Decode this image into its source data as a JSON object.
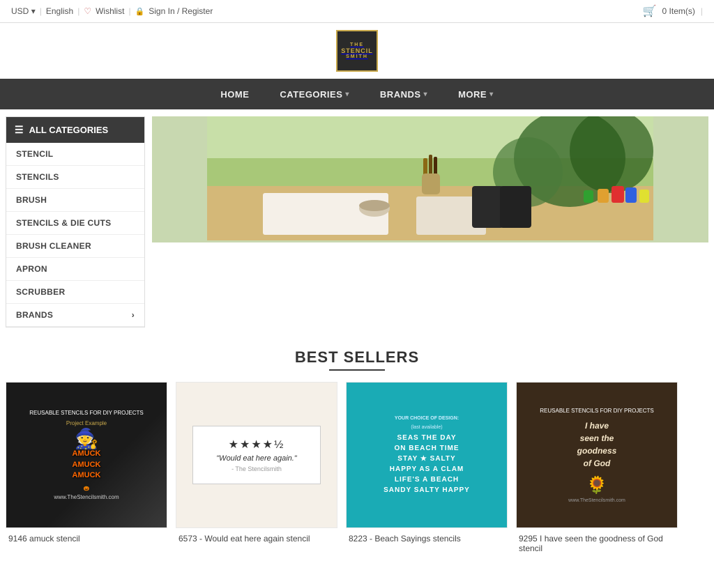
{
  "topbar": {
    "currency": "USD",
    "currency_arrow": "▾",
    "sep1": "|",
    "language": "English",
    "sep2": "|",
    "wishlist": "Wishlist",
    "sep3": "|",
    "signin": "Sign In / Register",
    "sep4": "|",
    "cart_label": "0 Item(s)",
    "sep5": "|"
  },
  "logo": {
    "line1": "THE",
    "line2": "STENCIL",
    "line3": "SMITH"
  },
  "nav": {
    "items": [
      {
        "label": "HOME",
        "has_dropdown": false
      },
      {
        "label": "CATEGORIES",
        "has_dropdown": true
      },
      {
        "label": "BRANDS",
        "has_dropdown": true
      },
      {
        "label": "MORE",
        "has_dropdown": true
      }
    ]
  },
  "sidebar": {
    "header": "ALL CATEGORIES",
    "items": [
      {
        "label": "STENCIL",
        "has_arrow": false
      },
      {
        "label": "STENCILS",
        "has_arrow": false
      },
      {
        "label": "BRUSH",
        "has_arrow": false
      },
      {
        "label": "STENCILS & DIE CUTS",
        "has_arrow": false
      },
      {
        "label": "BRUSH CLEANER",
        "has_arrow": false
      },
      {
        "label": "APRON",
        "has_arrow": false
      },
      {
        "label": "SCRUBBER",
        "has_arrow": false
      },
      {
        "label": "BRANDS",
        "has_arrow": true
      }
    ]
  },
  "best_sellers": {
    "title": "BEST SELLERS",
    "products": [
      {
        "id": "prod1",
        "name": "9146 amuck stencil",
        "top_label": "REUSABLE STENCILS for DIY projects",
        "main_text": "AMUCK\nAMUCK\nAMUCK",
        "sub_label": "www.TheStencilsmith.com"
      },
      {
        "id": "prod2",
        "name": "6573 - Would eat here again stencil",
        "stars": "★★★★½",
        "quote": "\"Would eat here again.\"",
        "attr": "- The Stencilsmith"
      },
      {
        "id": "prod3",
        "name": "8223 - Beach Sayings stencils",
        "lines": [
          "YOUR CHOICE OF DESIGN:",
          "SEAS THE DAY",
          "ON BEACH TIME",
          "STAY ★ SALTY",
          "HAPPY AS A CLAM",
          "LIFE'S A BEACH",
          "SANDY SALTY HAPPY"
        ]
      },
      {
        "id": "prod4",
        "name": "9295 I have seen the goodness of God stencil",
        "top_label": "REUSABLE STENCILS for DIY projects",
        "main_text": "I have\nseen the\ngoodness\nof God"
      }
    ]
  }
}
